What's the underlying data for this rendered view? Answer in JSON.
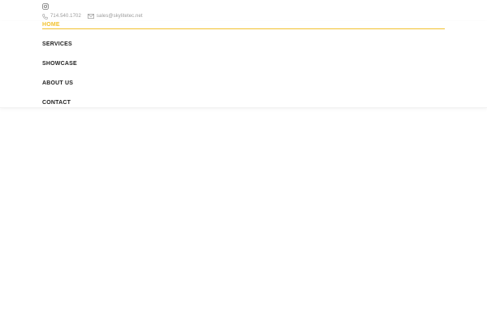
{
  "topbar": {
    "instagram_icon": "instagram-icon",
    "phone": "714.540.1702",
    "phone_icon": "phone-icon",
    "email": "sales@skylitetec.net",
    "email_icon": "envelope-icon"
  },
  "nav": {
    "accent_color": "#f2c12e",
    "items": [
      {
        "label": "HOME",
        "active": true
      },
      {
        "label": "SERVICES",
        "active": false
      },
      {
        "label": "SHOWCASE",
        "active": false
      },
      {
        "label": "ABOUT US",
        "active": false
      },
      {
        "label": "CONTACT",
        "active": false
      }
    ]
  }
}
